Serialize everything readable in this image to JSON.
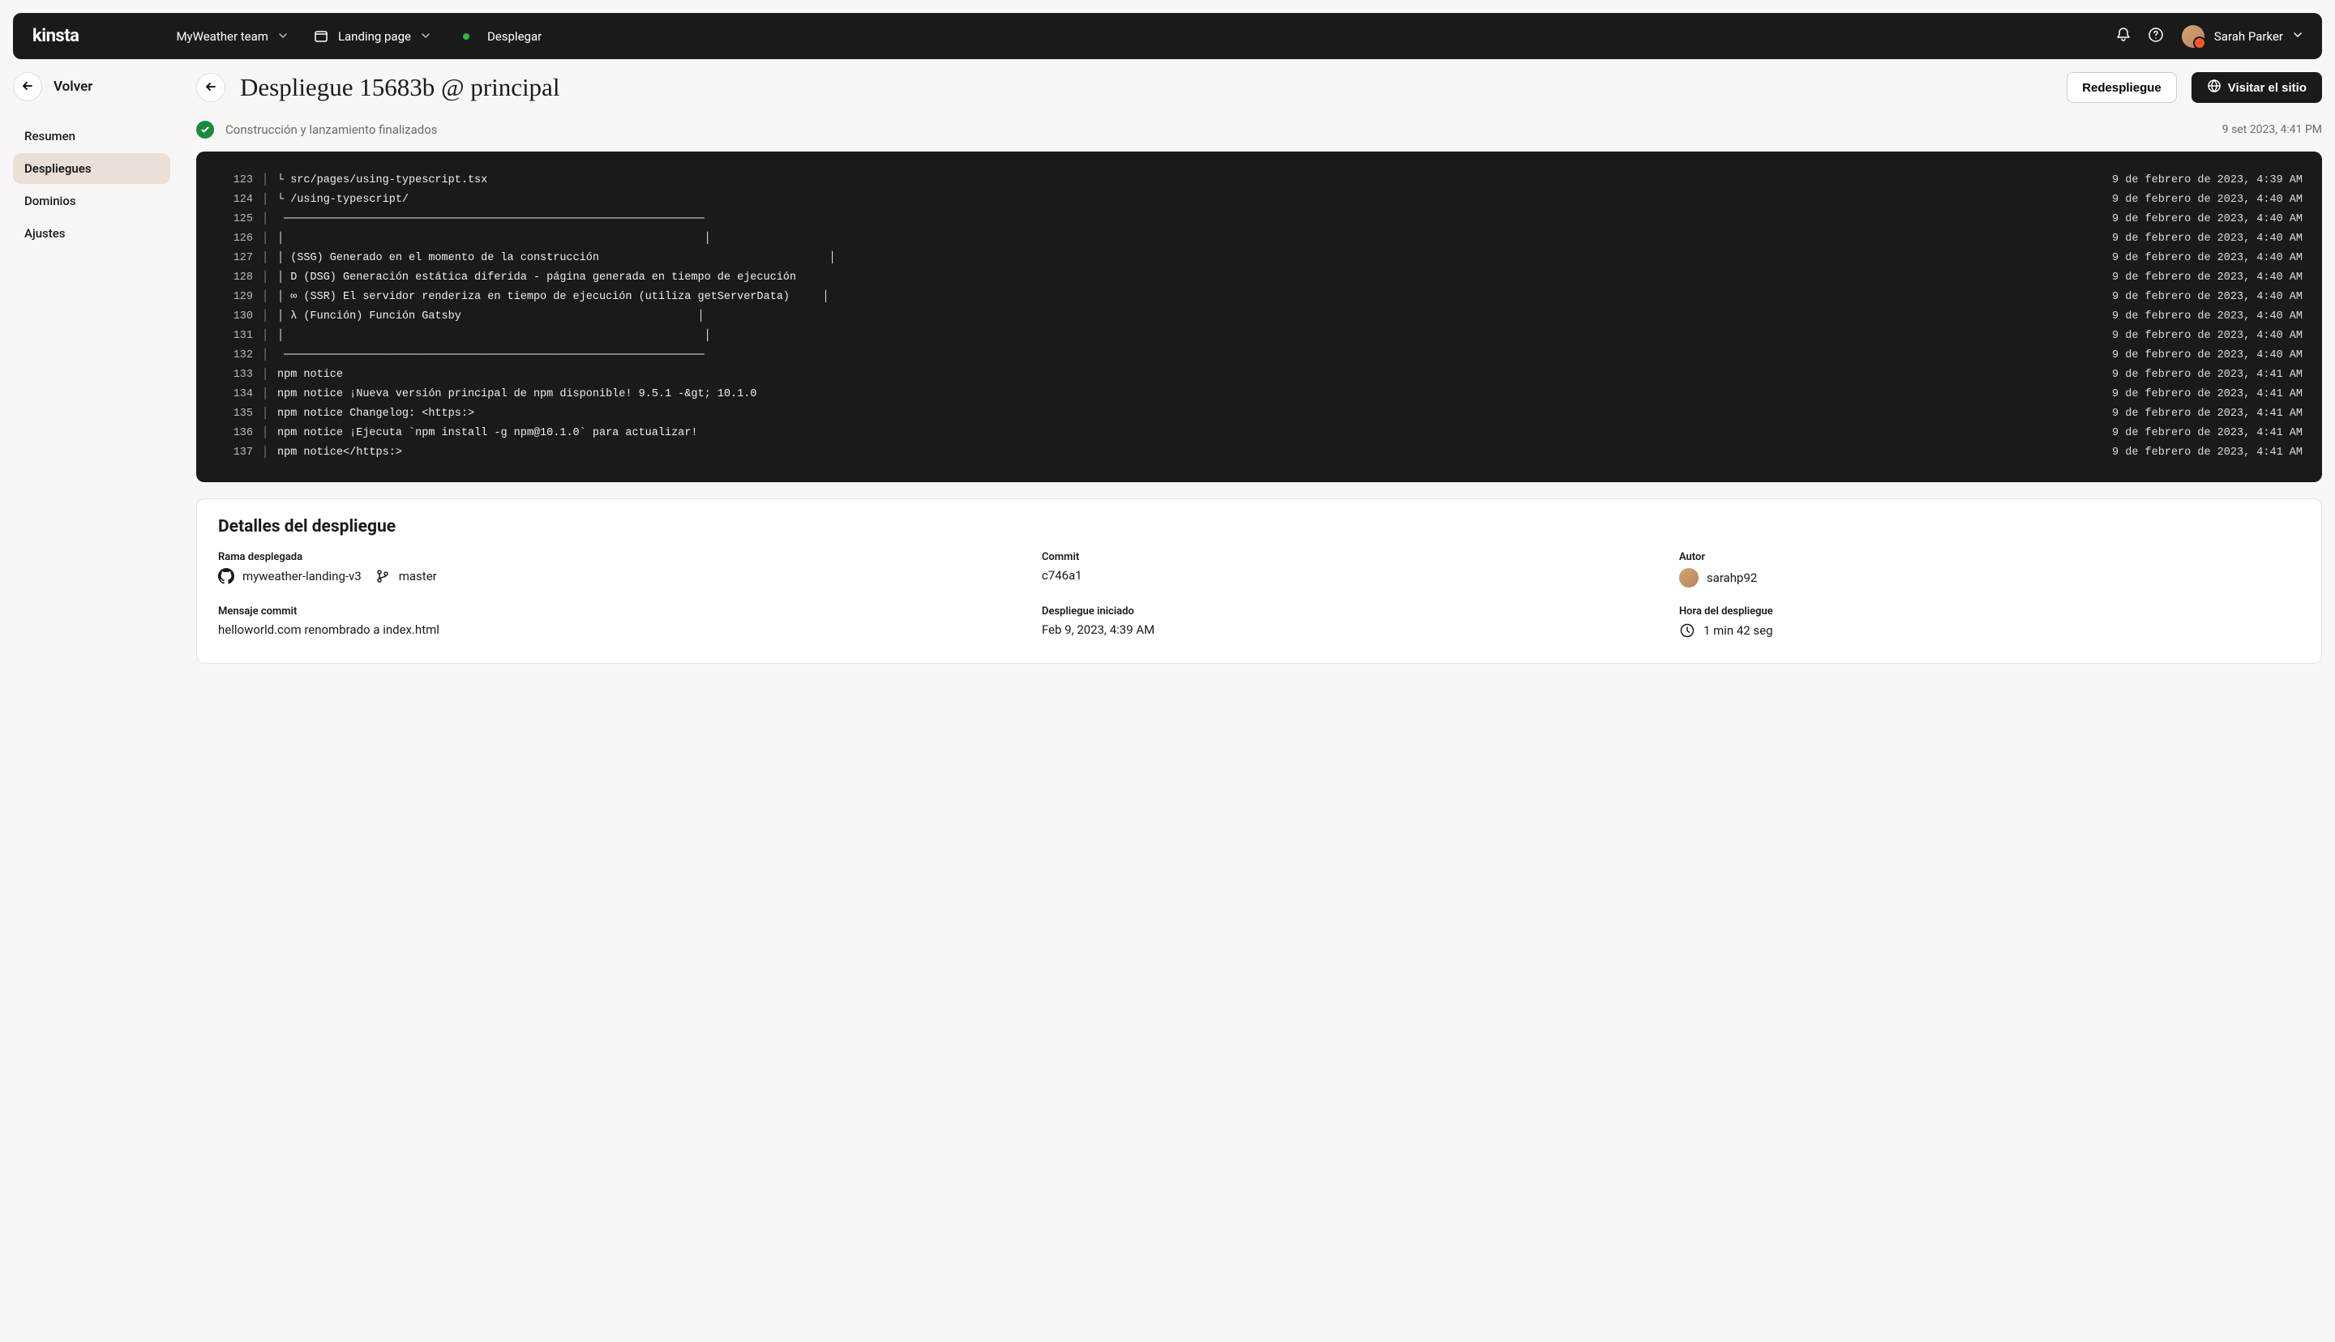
{
  "topbar": {
    "logo": "kinsta",
    "team": "MyWeather team",
    "page": "Landing page",
    "status": "Desplegar",
    "user": "Sarah Parker"
  },
  "sidebar": {
    "back": "Volver",
    "items": [
      {
        "label": "Resumen",
        "active": false
      },
      {
        "label": "Despliegues",
        "active": true
      },
      {
        "label": "Dominios",
        "active": false
      },
      {
        "label": "Ajustes",
        "active": false
      }
    ]
  },
  "header": {
    "title": "Despliegue 15683b @ principal",
    "redeploy": "Redespliegue",
    "visit": "Visitar el sitio"
  },
  "status": {
    "text": "Construcción y lanzamiento finalizados",
    "time": "9 set 2023, 4:41 PM"
  },
  "log": [
    {
      "n": "123",
      "t": "└ src/pages/using-typescript.tsx",
      "ts": "9 de febrero de 2023, 4:39 AM"
    },
    {
      "n": "124",
      "t": "└ /using-typescript/",
      "ts": "9 de febrero de 2023, 4:40 AM"
    },
    {
      "n": "125",
      "t": " ────────────────────────────────────────────────────────────────",
      "ts": "9 de febrero de 2023, 4:40 AM"
    },
    {
      "n": "126",
      "t": "│                                                                │",
      "ts": "9 de febrero de 2023, 4:40 AM"
    },
    {
      "n": "127",
      "t": "│ (SSG) Generado en el momento de la construcción                                   │",
      "ts": "9 de febrero de 2023, 4:40 AM"
    },
    {
      "n": "128",
      "t": "│ D (DSG) Generación estática diferida - página generada en tiempo de ejecución",
      "ts": "9 de febrero de 2023, 4:40 AM"
    },
    {
      "n": "129",
      "t": "│ ∞ (SSR) El servidor renderiza en tiempo de ejecución (utiliza getServerData)     │",
      "ts": "9 de febrero de 2023, 4:40 AM"
    },
    {
      "n": "130",
      "t": "│ λ (Función) Función Gatsby                                    │",
      "ts": "9 de febrero de 2023, 4:40 AM"
    },
    {
      "n": "131",
      "t": "│                                                                │",
      "ts": "9 de febrero de 2023, 4:40 AM"
    },
    {
      "n": "132",
      "t": " ────────────────────────────────────────────────────────────────",
      "ts": "9 de febrero de 2023, 4:40 AM"
    },
    {
      "n": "133",
      "t": "npm notice",
      "ts": "9 de febrero de 2023, 4:41 AM"
    },
    {
      "n": "134",
      "t": "npm notice ¡Nueva versión principal de npm disponible! 9.5.1 -&gt; 10.1.0",
      "ts": "9 de febrero de 2023, 4:41 AM"
    },
    {
      "n": "135",
      "t": "npm notice Changelog: <https:>",
      "ts": "9 de febrero de 2023, 4:41 AM"
    },
    {
      "n": "136",
      "t": "npm notice ¡Ejecuta `npm install -g npm@10.1.0` para actualizar!",
      "ts": "9 de febrero de 2023, 4:41 AM"
    },
    {
      "n": "137",
      "t": "npm notice</https:>",
      "ts": "9 de febrero de 2023, 4:41 AM"
    }
  ],
  "details": {
    "title": "Detalles del despliegue",
    "branch_label": "Rama desplegada",
    "repo": "myweather-landing-v3",
    "branch": "master",
    "commit_label": "Commit",
    "commit": "c746a1",
    "author_label": "Autor",
    "author": "sarahp92",
    "msg_label": "Mensaje commit",
    "msg": "helloworld.com renombrado a index.html",
    "started_label": "Despliegue iniciado",
    "started": "Feb 9, 2023, 4:39 AM",
    "duration_label": "Hora del despliegue",
    "duration": "1 min 42 seg"
  }
}
